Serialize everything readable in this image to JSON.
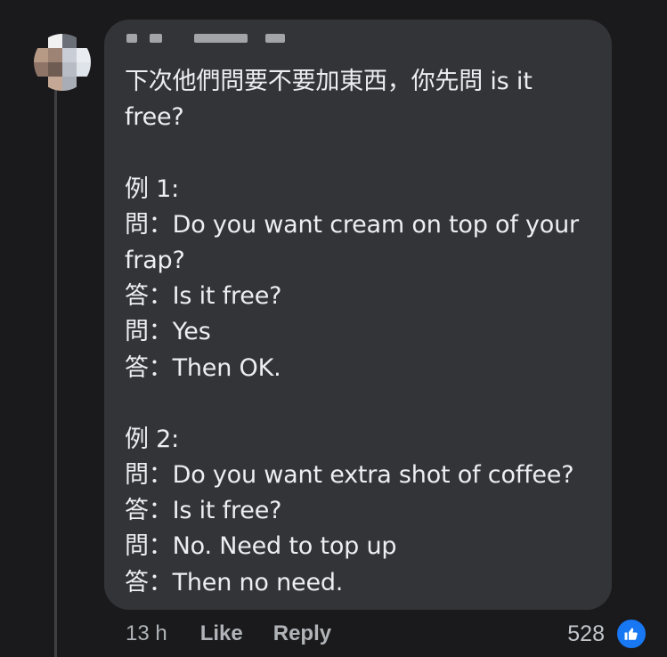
{
  "comment": {
    "author": "",
    "lines": [
      "下次他們問要不要加東西，你先問 is it",
      "free?",
      "",
      "例 1:",
      "問：Do you want cream on top of your",
      "frap?",
      "答：Is it free?",
      "問：Yes",
      "答：Then OK.",
      "",
      "例 2:",
      "問：Do you want extra shot of coffee?",
      "答：Is it free?",
      "問：No. Need to top up",
      "答：Then no need."
    ],
    "timestamp": "13 h",
    "like_label": "Like",
    "reply_label": "Reply",
    "reaction_count": "528",
    "reaction_icon": "thumbs-up-icon"
  },
  "colors": {
    "background": "#1a1a1c",
    "bubble": "#333438",
    "text": "#eceef1",
    "meta": "#b0b3b8",
    "like_blue": "#1877f2"
  }
}
